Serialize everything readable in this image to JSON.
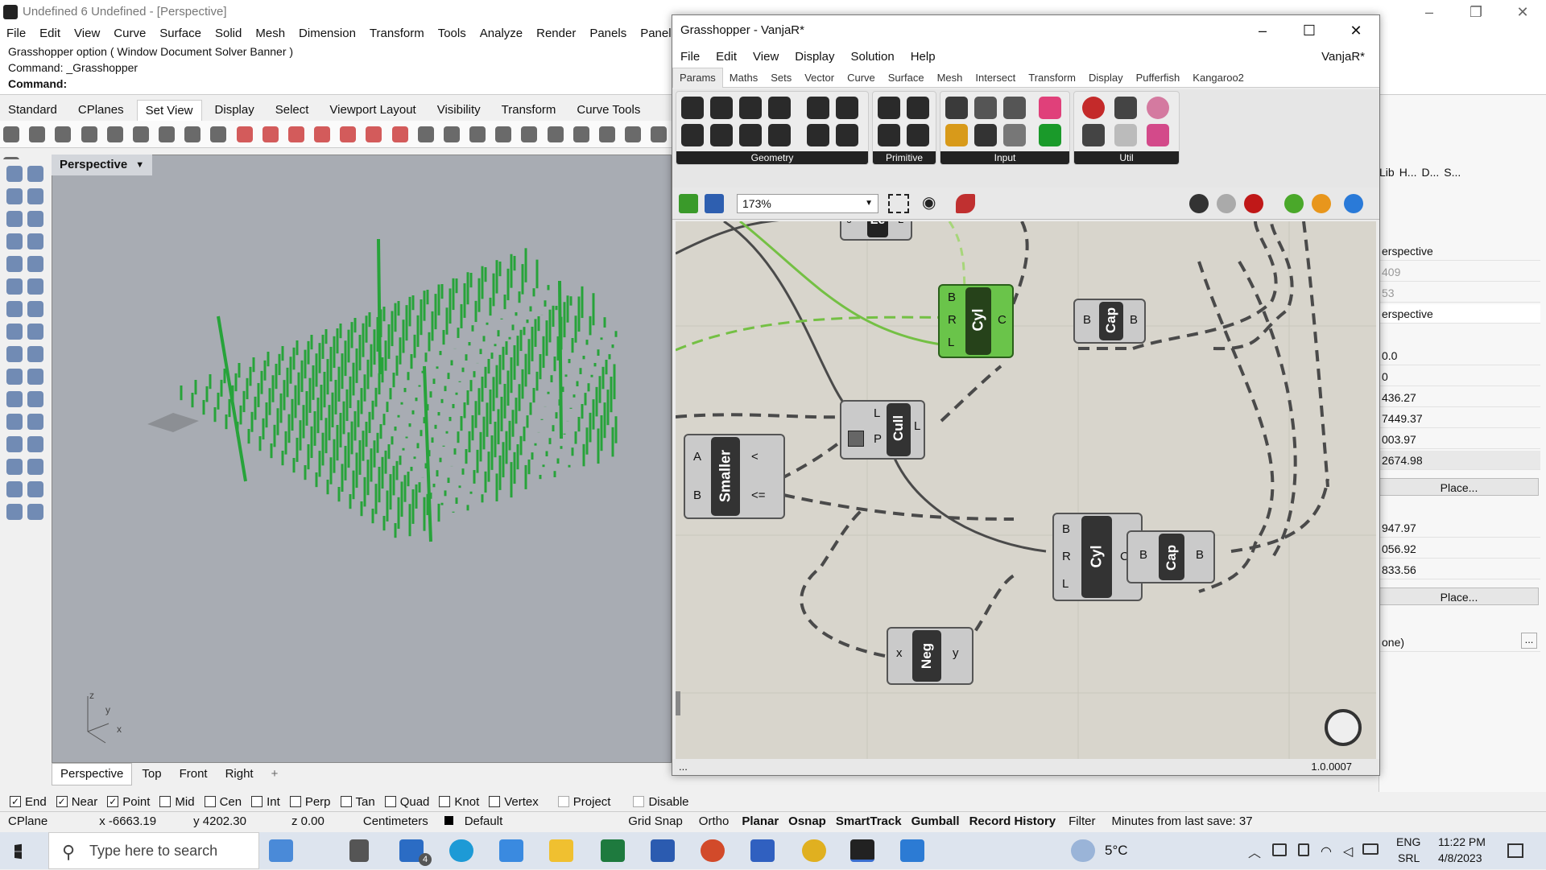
{
  "rhino": {
    "title": "Undefined 6 Undefined - [Perspective]",
    "menu": [
      "File",
      "Edit",
      "View",
      "Curve",
      "Surface",
      "Solid",
      "Mesh",
      "Dimension",
      "Transform",
      "Tools",
      "Analyze",
      "Render",
      "Panels",
      "Paneling Tools"
    ],
    "cmd_line1": "Grasshopper option ( Window  Document  Solver  Banner )",
    "cmd_line2": "Command: _Grasshopper",
    "cmd_prompt": "Command:",
    "tabs": [
      "Standard",
      "CPlanes",
      "Set View",
      "Display",
      "Select",
      "Viewport Layout",
      "Visibility",
      "Transform",
      "Curve Tools"
    ],
    "active_tab": "Set View",
    "viewport_label": "Perspective",
    "viewport_tabs": [
      "Perspective",
      "Top",
      "Front",
      "Right"
    ],
    "axis_labels": {
      "z": "z",
      "y": "y",
      "x": "x"
    },
    "osnaps": [
      {
        "label": "End",
        "checked": true
      },
      {
        "label": "Near",
        "checked": true
      },
      {
        "label": "Point",
        "checked": true
      },
      {
        "label": "Mid",
        "checked": false
      },
      {
        "label": "Cen",
        "checked": false
      },
      {
        "label": "Int",
        "checked": false
      },
      {
        "label": "Perp",
        "checked": false
      },
      {
        "label": "Tan",
        "checked": false
      },
      {
        "label": "Quad",
        "checked": false
      },
      {
        "label": "Knot",
        "checked": false
      },
      {
        "label": "Vertex",
        "checked": false
      },
      {
        "label": "Project",
        "checked": false
      },
      {
        "label": "Disable",
        "checked": false
      }
    ],
    "status": {
      "cplane": "CPlane",
      "x": "x -6663.19",
      "y": "y 4202.30",
      "z": "z 0.00",
      "units": "Centimeters",
      "layer": "Default",
      "toggles": [
        "Grid Snap",
        "Ortho",
        "Planar",
        "Osnap",
        "SmartTrack",
        "Gumball",
        "Record History",
        "Filter"
      ],
      "bold_toggles": [
        "Planar",
        "Osnap",
        "SmartTrack",
        "Gumball",
        "Record History"
      ],
      "save": "Minutes from last save: 37"
    },
    "right_panel": {
      "tabs": [
        "Lib",
        "H...",
        "D...",
        "S..."
      ],
      "values": [
        "erspective",
        "409",
        "53",
        "erspective",
        "0.0",
        "0",
        "436.27",
        "7449.37",
        "003.97",
        "2674.98"
      ],
      "place_label": "Place...",
      "values2": [
        "947.97",
        "056.92",
        "833.56"
      ],
      "none_value": "one)",
      "ellipsis": "..."
    }
  },
  "gh": {
    "title": "Grasshopper - VanjaR*",
    "doc_name": "VanjaR*",
    "menu": [
      "File",
      "Edit",
      "View",
      "Display",
      "Solution",
      "Help"
    ],
    "tabs": [
      "Params",
      "Maths",
      "Sets",
      "Vector",
      "Curve",
      "Surface",
      "Mesh",
      "Intersect",
      "Transform",
      "Display",
      "Pufferfish",
      "Kangaroo2"
    ],
    "active_tab": "Params",
    "groups": [
      "Geometry",
      "Primitive",
      "Input",
      "Util"
    ],
    "zoom": "173%",
    "footer_left": "...",
    "version": "1.0.0007",
    "components": [
      {
        "name": "Cyl",
        "inputs": [
          "B",
          "R",
          "L"
        ],
        "outputs": [
          "C"
        ],
        "selected": true
      },
      {
        "name": "Cap",
        "inputs": [
          "B"
        ],
        "outputs": [
          "B"
        ]
      },
      {
        "name": "Cull",
        "inputs": [
          "L",
          "P"
        ],
        "outputs": [
          "L"
        ]
      },
      {
        "name": "Smaller",
        "inputs": [
          "A",
          "B"
        ],
        "outputs": [
          "<",
          "<="
        ]
      },
      {
        "name": "Cyl",
        "inputs": [
          "B",
          "R",
          "L"
        ],
        "outputs": [
          "C"
        ]
      },
      {
        "name": "Cap",
        "inputs": [
          "B"
        ],
        "outputs": [
          "B"
        ]
      },
      {
        "name": "Neg",
        "inputs": [
          "x"
        ],
        "outputs": [
          "y"
        ]
      },
      {
        "name": "Le",
        "inputs": [
          "c"
        ],
        "outputs": [
          "L"
        ]
      }
    ]
  },
  "taskbar": {
    "search_placeholder": "Type here to search",
    "mail_badge": "4",
    "weather": "5°C",
    "lang1": "ENG",
    "lang2": "SRL",
    "time": "11:22 PM",
    "date": "4/8/2023"
  }
}
